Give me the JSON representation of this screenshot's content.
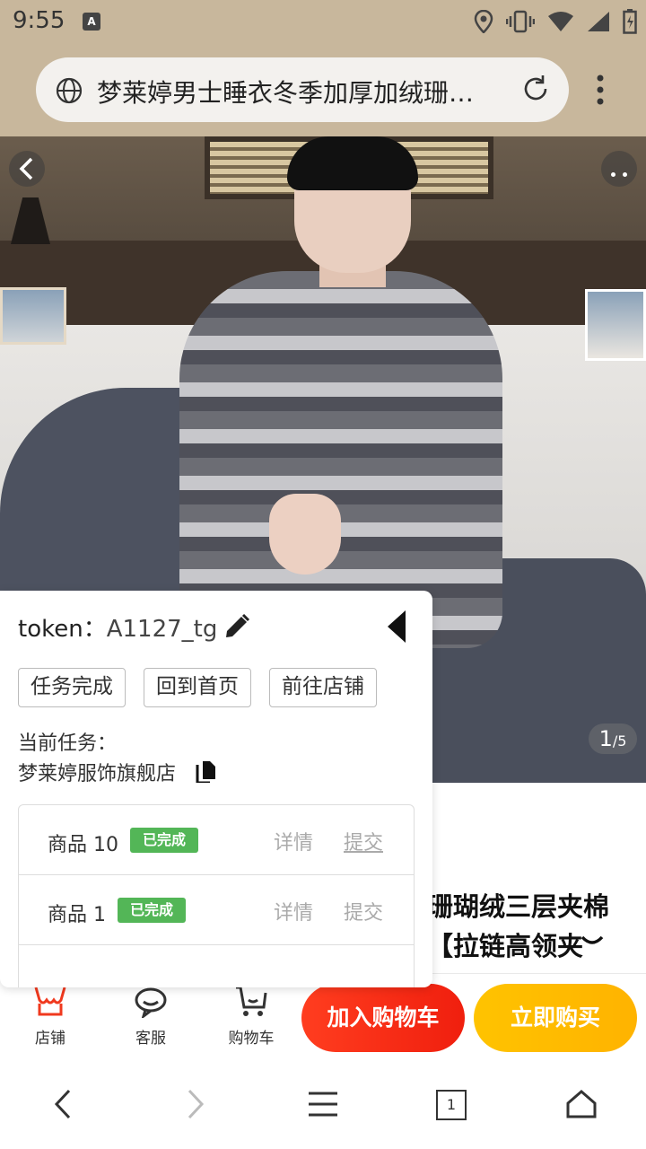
{
  "status_bar": {
    "time": "9:55",
    "notif_icon": "A"
  },
  "browser": {
    "url_title": "梦莱婷男士睡衣冬季加厚加绒珊…"
  },
  "hero": {
    "counter_current": "1",
    "counter_total": "/5"
  },
  "product": {
    "title_line1": "珊瑚绒三层夹棉",
    "title_line2": "【拉链高领夹"
  },
  "bottom_bar": {
    "shop": "店铺",
    "service": "客服",
    "cart": "购物车",
    "add_to_cart": "加入购物车",
    "buy_now": "立即购买"
  },
  "nav": {
    "tab_count": "1"
  },
  "panel": {
    "token_label": "token：",
    "token_value": "A1127_tg",
    "buttons": [
      "任务完成",
      "回到首页",
      "前往店铺"
    ],
    "task_label": "当前任务：",
    "shop_name": "梦莱婷服饰旗舰店",
    "rows": [
      {
        "name": "商品 10",
        "status": "已完成",
        "detail": "详情",
        "submit": "提交"
      },
      {
        "name": "商品 1",
        "status": "已完成",
        "detail": "详情",
        "submit": "提交"
      }
    ]
  },
  "colors": {
    "status_bg": "#c8b79c",
    "cart_red": "#f01f0e",
    "buy_yellow": "#ffb300",
    "badge_green": "#53b657"
  }
}
